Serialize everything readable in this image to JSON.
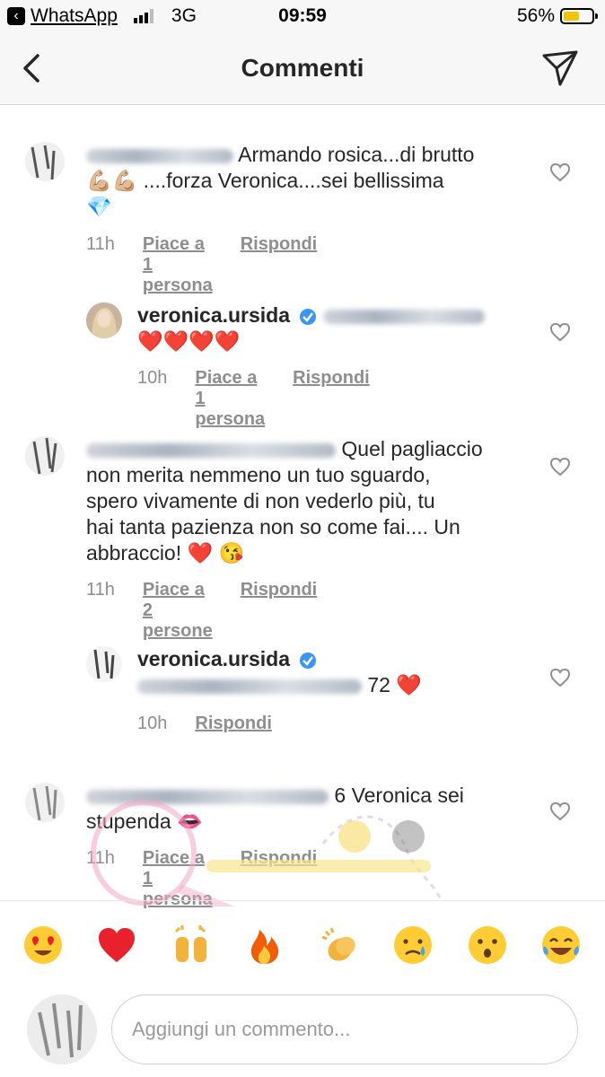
{
  "status_bar": {
    "back_app": "WhatsApp",
    "network": "3G",
    "time": "09:59",
    "battery_percent_text": "56%",
    "battery_level": 0.56
  },
  "header": {
    "title": "Commenti",
    "back_icon": "chevron-left-icon",
    "send_icon": "paper-plane-icon"
  },
  "comments": [
    {
      "text_line1": "Armando rosica...di brutto",
      "text_line2": "....forza Veronica....sei bellissima",
      "emoji": [
        "💪🏼",
        "💪🏼",
        "💎"
      ],
      "time": "11h",
      "likes": "Piace a 1 persona",
      "reply": "Rispondi"
    },
    {
      "username": "veronica.ursida",
      "hearts": "❤️❤️❤️❤️",
      "time": "10h",
      "likes": "Piace a 1 persona",
      "reply": "Rispondi"
    },
    {
      "text_line1": "Quel pagliaccio",
      "text_line2": "non merita nemmeno un tuo sguardo,",
      "text_line3": "spero vivamente di non vederlo più, tu",
      "text_line4": "hai tanta pazienza non so come fai.... Un",
      "text_line5": "abbraccio! ❤️ 😘",
      "time": "11h",
      "likes": "Piace a 2 persone",
      "reply": "Rispondi"
    },
    {
      "username": "veronica.ursida",
      "tail": "72 ❤️",
      "time": "10h",
      "reply": "Rispondi"
    },
    {
      "text_line1": "6 Veronica sei",
      "text_line2": "stupenda 👄",
      "time": "11h",
      "likes": "Piace a 1 persona",
      "reply": "Rispondi"
    }
  ],
  "emoji_bar": [
    "😍",
    "❤️",
    "🙌",
    "🔥",
    "👏",
    "😢",
    "😮",
    "😂"
  ],
  "comment_input": {
    "placeholder": "Aggiungi un commento..."
  }
}
